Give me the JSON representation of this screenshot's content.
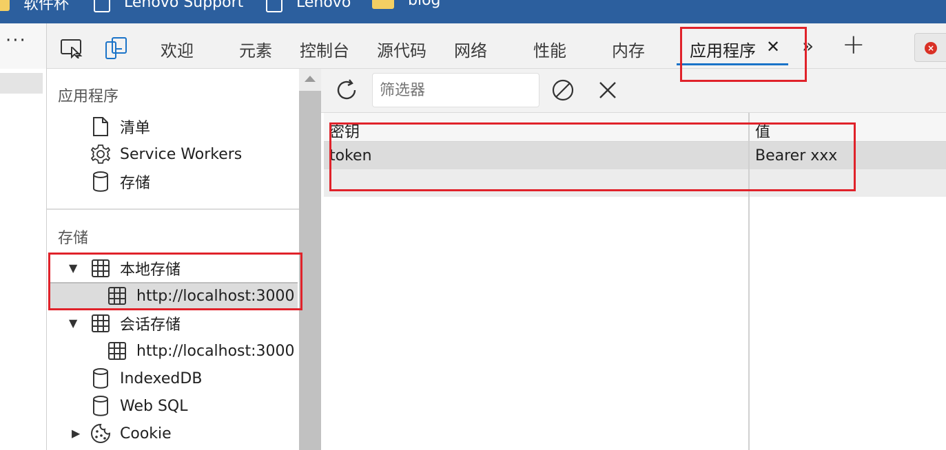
{
  "bookmarks": [
    {
      "label": "软件杯",
      "icon": "folder-icon"
    },
    {
      "label": "Lenovo Support",
      "icon": "page-icon"
    },
    {
      "label": "Lenovo",
      "icon": "page-icon"
    },
    {
      "label": "blog",
      "icon": "folder-icon"
    }
  ],
  "toolbar": {
    "menu_label": "···",
    "tabs": [
      {
        "label": "欢迎"
      },
      {
        "label": "元素"
      },
      {
        "label": "控制台"
      },
      {
        "label": "源代码"
      },
      {
        "label": "网络"
      },
      {
        "label": "性能"
      },
      {
        "label": "内存"
      },
      {
        "label": "应用程序",
        "active": true
      }
    ],
    "close_symbol": "✕",
    "more_symbol": "»",
    "add_symbol": "+",
    "error_symbol": "×"
  },
  "sidebar": {
    "app_section": {
      "title": "应用程序",
      "items": [
        {
          "label": "清单",
          "icon": "document-icon"
        },
        {
          "label": "Service Workers",
          "icon": "gear-icon"
        },
        {
          "label": "存储",
          "icon": "database-icon"
        }
      ]
    },
    "storage_section": {
      "title": "存储",
      "local_storage": {
        "label": "本地存储",
        "icon": "grid-icon",
        "children": [
          {
            "label": "http://localhost:3000",
            "selected": true
          }
        ]
      },
      "session_storage": {
        "label": "会话存储",
        "icon": "grid-icon",
        "children": [
          {
            "label": "http://localhost:3000"
          }
        ]
      },
      "indexeddb": {
        "label": "IndexedDB",
        "icon": "database-icon"
      },
      "websql": {
        "label": "Web SQL",
        "icon": "database-icon"
      },
      "cookie": {
        "label": "Cookie",
        "icon": "cookie-icon"
      }
    }
  },
  "main": {
    "filter_placeholder": "筛选器",
    "columns": {
      "key": "密钥",
      "value": "值"
    },
    "rows": [
      {
        "key": "token",
        "value": "Bearer xxx"
      }
    ]
  },
  "colors": {
    "accent": "#1a73c8",
    "highlight": "#e0222a",
    "bookmark_bar": "#2c5f9e"
  }
}
